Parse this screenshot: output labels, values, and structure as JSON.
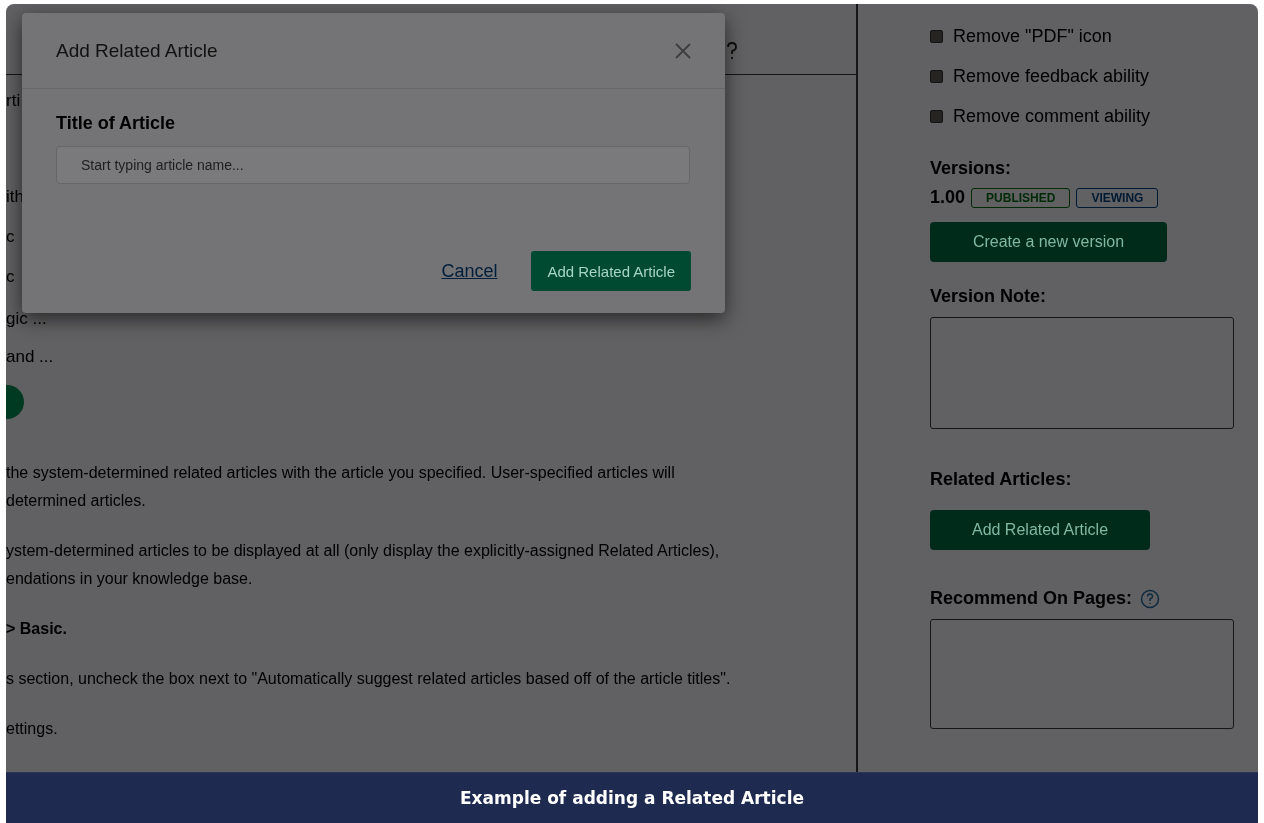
{
  "editor": {
    "fragments": [
      "rti",
      "ith",
      "c",
      "c",
      "gic ...",
      "and ..."
    ],
    "paragraphs": [
      {
        "kind": "plain",
        "lines": [
          "the system-determined related articles with the article you specified. User-specified articles will",
          "determined articles."
        ]
      },
      {
        "kind": "plain",
        "lines": [
          "ystem-determined articles to be displayed at all (only display the explicitly-assigned Related Articles),",
          "endations in your knowledge base."
        ]
      },
      {
        "kind": "bold",
        "lines": [
          "> Basic."
        ]
      },
      {
        "kind": "plain",
        "lines": [
          "s section, uncheck the box next to \"Automatically suggest related articles based off of the article titles\"."
        ]
      },
      {
        "kind": "plain",
        "lines": [
          "ettings."
        ]
      }
    ]
  },
  "modal": {
    "title": "Add Related Article",
    "field_label": "Title of Article",
    "placeholder": "Start typing article name...",
    "cancel": "Cancel",
    "submit": "Add Related Article"
  },
  "sidebar": {
    "options": [
      {
        "label": "Remove \"PDF\" icon",
        "checked": false
      },
      {
        "label": "Remove feedback ability",
        "checked": false
      },
      {
        "label": "Remove comment ability",
        "checked": false
      }
    ],
    "versions_label": "Versions:",
    "version": "1.00",
    "badges": [
      {
        "label": "PUBLISHED",
        "color": "#002a06"
      },
      {
        "label": "VIEWING",
        "color": "#001a33"
      }
    ],
    "create_button": "Create a new version",
    "version_note_label": "Version Note:",
    "related_label": "Related Articles:",
    "add_related_button": "Add Related Article",
    "recommend_label": "Recommend On Pages:"
  },
  "caption": "Example of adding a Related Article"
}
